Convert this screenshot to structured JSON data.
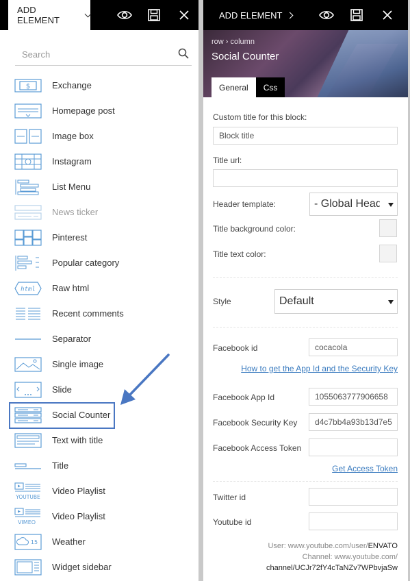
{
  "left_panel": {
    "add_element_label": "ADD ELEMENT",
    "search_placeholder": "Search",
    "items": [
      {
        "label": "Exchange",
        "icon": "exchange-icon"
      },
      {
        "label": "Homepage post",
        "icon": "homepage-post-icon"
      },
      {
        "label": "Image box",
        "icon": "image-box-icon"
      },
      {
        "label": "Instagram",
        "icon": "instagram-icon"
      },
      {
        "label": "List Menu",
        "icon": "list-menu-icon"
      },
      {
        "label": "News ticker",
        "icon": "news-ticker-icon",
        "disabled": true
      },
      {
        "label": "Pinterest",
        "icon": "pinterest-icon"
      },
      {
        "label": "Popular category",
        "icon": "popular-category-icon"
      },
      {
        "label": "Raw html",
        "icon": "raw-html-icon"
      },
      {
        "label": "Recent comments",
        "icon": "recent-comments-icon"
      },
      {
        "label": "Separator",
        "icon": "separator-icon"
      },
      {
        "label": "Single image",
        "icon": "single-image-icon"
      },
      {
        "label": "Slide",
        "icon": "slide-icon"
      },
      {
        "label": "Social Counter",
        "icon": "social-counter-icon",
        "highlighted": true
      },
      {
        "label": "Text with title",
        "icon": "text-with-title-icon"
      },
      {
        "label": "Title",
        "icon": "title-icon"
      },
      {
        "label": "Video Playlist",
        "icon": "video-playlist-youtube-icon"
      },
      {
        "label": "Video Playlist",
        "icon": "video-playlist-vimeo-icon"
      },
      {
        "label": "Weather",
        "icon": "weather-icon"
      },
      {
        "label": "Widget sidebar",
        "icon": "widget-sidebar-icon"
      }
    ],
    "icon_text": {
      "raw_html": "html",
      "youtube": "YOUTUBE",
      "vimeo": "VIMEO",
      "weather": "15",
      "exchange": "$"
    }
  },
  "right_panel": {
    "add_element_label": "ADD ELEMENT",
    "breadcrumb": "row › column",
    "block_title": "Social Counter",
    "tabs": [
      "General",
      "Css"
    ],
    "fields": {
      "custom_title_label": "Custom title for this block:",
      "custom_title_value": "Block title",
      "title_url_label": "Title url:",
      "title_url_value": "",
      "header_template_label": "Header template:",
      "header_template_value": "- Global Head",
      "title_bg_label": "Title background color:",
      "title_text_label": "Title text color:",
      "style_label": "Style",
      "style_value": "Default",
      "facebook_id_label": "Facebook id",
      "facebook_id_value": "cocacola",
      "security_key_link": "How to get the App Id and the Security Key",
      "facebook_app_id_label": "Facebook App Id",
      "facebook_app_id_value": "1055063777906658",
      "facebook_security_key_label": "Facebook Security Key",
      "facebook_security_key_value": "d4c7bb4a93b13d7e5",
      "facebook_access_token_label": "Facebook Access Token",
      "facebook_access_token_value": "",
      "get_access_token_link": "Get Access Token",
      "twitter_id_label": "Twitter id",
      "twitter_id_value": "",
      "youtube_id_label": "Youtube id",
      "youtube_id_value": ""
    },
    "youtube_note": {
      "line1_prefix": "User: www.youtube.com/user/",
      "line1_bold": "ENVATO",
      "line2": "Channel: www.youtube.com/",
      "line3": "channel/UCJr72fY4cTaNZv7WPbvjaSw"
    }
  },
  "colors": {
    "accent": "#4a77c2",
    "link": "#3a7bbf",
    "topbar": "#000000"
  }
}
